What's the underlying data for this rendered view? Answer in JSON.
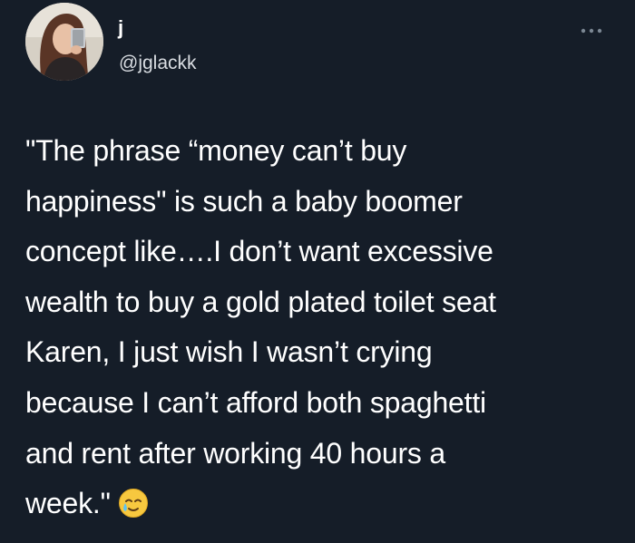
{
  "tweet": {
    "display_name": "j",
    "handle": "@jglackk",
    "more_icon": "ellipsis-icon",
    "avatar_icon": "profile-photo",
    "emoji_icon": "smiling-face-with-tear-emoji",
    "text_lines": [
      "\"The phrase “money can’t buy",
      "happiness\" is such a baby boomer",
      "concept like….I don’t want excessive",
      "wealth to buy a gold plated toilet seat",
      "Karen, I just wish I wasn’t crying",
      "because I can’t afford both spaghetti",
      "and rent after working 40 hours a",
      "week.\""
    ]
  },
  "colors": {
    "background": "#151d28",
    "text": "#ffffff",
    "secondary_text": "#d9dde2",
    "icon_gray": "#7b8793"
  }
}
